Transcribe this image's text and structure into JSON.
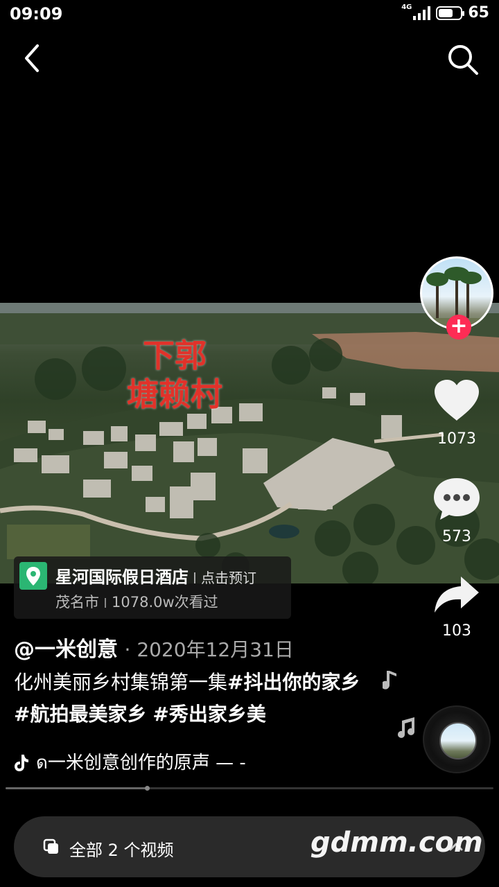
{
  "status_bar": {
    "time": "09:09",
    "network": "4G",
    "battery": "65",
    "battery_level": 0.65
  },
  "nav": {
    "back_icon": "chevron-left-icon",
    "search_icon": "search-icon"
  },
  "video": {
    "overlay_line1": "下郭",
    "overlay_line2": "塘赖村"
  },
  "actions": {
    "follow_symbol": "+",
    "likes": "1073",
    "comments": "573",
    "shares": "103"
  },
  "location": {
    "name": "星河国际假日酒店",
    "cta": "点击预订",
    "city": "茂名市",
    "views": "1078.0w次看过"
  },
  "post": {
    "author": "@一米创意",
    "date": "· 2020年12月31日",
    "text": "化州美丽乡村集锦第一集",
    "hashtag1": "#抖出你的家乡",
    "hashtag2": "#航拍最美家乡",
    "hashtag3": "#秀出家乡美",
    "music": "ด一米创意创作的原声 — -"
  },
  "playback": {
    "progress": 0.29
  },
  "bottom_bar": {
    "collection": "全部 2 个视频",
    "watermark": "gdmm.com"
  },
  "colors": {
    "accent": "#fe2c55",
    "location_green": "#2bb673",
    "overlay_red": "#e1322a"
  }
}
